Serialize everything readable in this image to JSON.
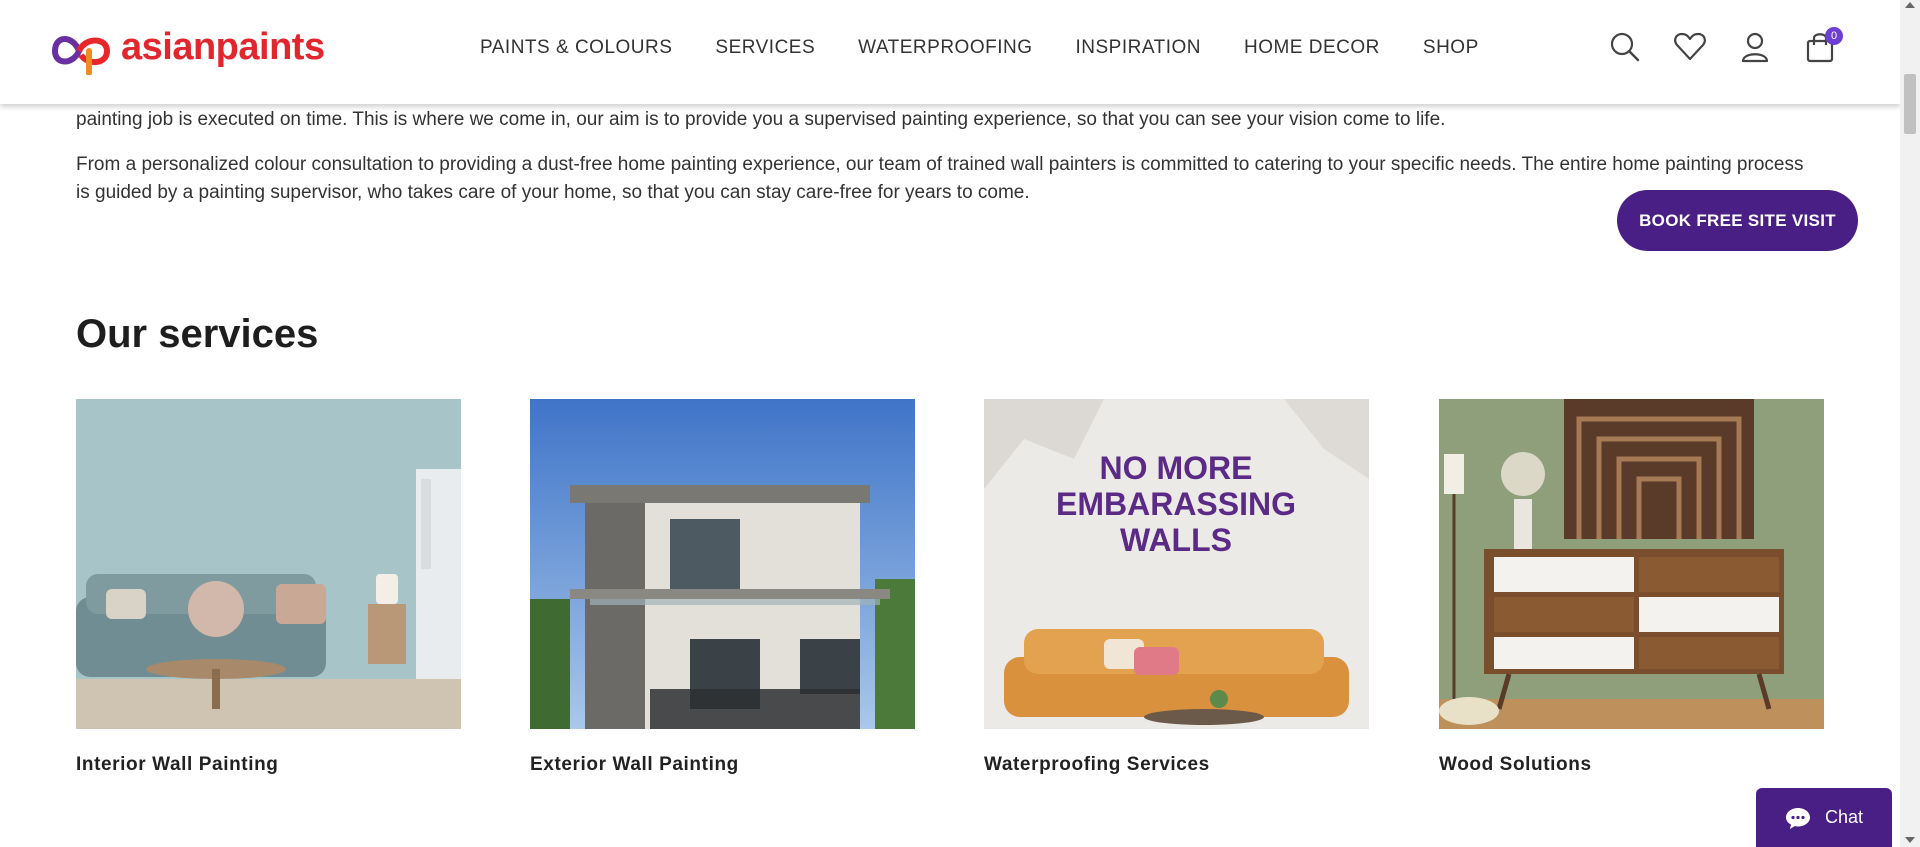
{
  "brand": {
    "name": "asianpaints",
    "color": "#e2262e"
  },
  "nav": {
    "items": [
      "PAINTS & COLOURS",
      "SERVICES",
      "WATERPROOFING",
      "INSPIRATION",
      "HOME DECOR",
      "SHOP"
    ],
    "icons": [
      "search-icon",
      "wishlist-heart-icon",
      "user-account-icon",
      "cart-bag-icon"
    ],
    "cart_count": "0"
  },
  "intro": {
    "paragraph_1": "painting job is executed on time. This is where we come in, our aim is to provide you a supervised painting experience, so that you can see your vision come to life.",
    "paragraph_2": "From a personalized colour consultation to providing a dust-free home painting experience, our team of trained wall painters is committed to catering to your specific needs. The entire home painting process is guided by a painting supervisor, who takes care of your home, so that you can stay care-free for years to come."
  },
  "cta": {
    "label": "BOOK FREE SITE VISIT",
    "color": "#4a1f85"
  },
  "services": {
    "title": "Our services",
    "cards": [
      {
        "label": "Interior Wall Painting"
      },
      {
        "label": "Exterior Wall Painting"
      },
      {
        "label": "Waterproofing Services",
        "image_text": [
          "NO MORE",
          "EMBARASSING",
          "WALLS"
        ]
      },
      {
        "label": "Wood Solutions"
      }
    ]
  },
  "chat": {
    "label": "Chat"
  }
}
